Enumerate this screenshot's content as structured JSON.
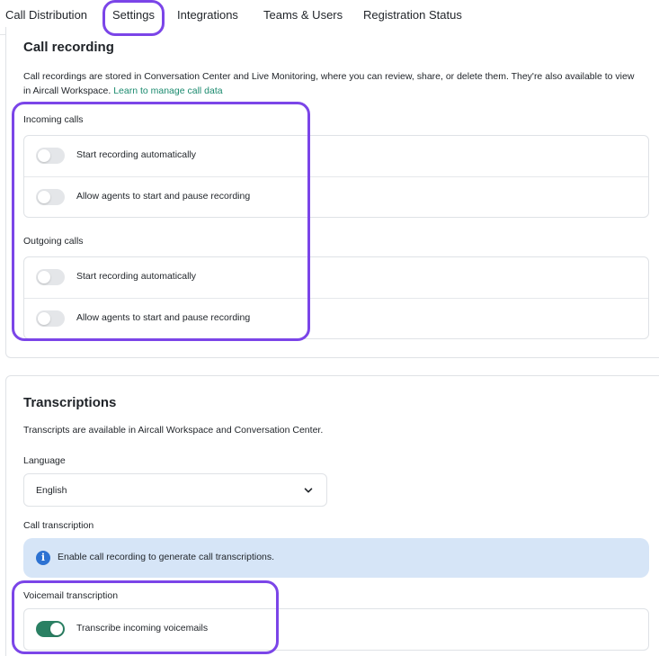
{
  "tabs": [
    {
      "label": "Call Distribution"
    },
    {
      "label": "Settings"
    },
    {
      "label": "Integrations"
    },
    {
      "label": "Teams & Users"
    },
    {
      "label": "Registration Status"
    }
  ],
  "call_recording": {
    "title": "Call recording",
    "description": "Call recordings are stored in Conversation Center and Live Monitoring, where you can review, share, or delete them. They're also available to view in Aircall Workspace.",
    "link": "Learn to manage call data",
    "incoming": {
      "label": "Incoming calls",
      "rows": [
        {
          "label": "Start recording automatically",
          "enabled": false
        },
        {
          "label": "Allow agents to start and pause recording",
          "enabled": false
        }
      ]
    },
    "outgoing": {
      "label": "Outgoing calls",
      "rows": [
        {
          "label": "Start recording automatically",
          "enabled": false
        },
        {
          "label": "Allow agents to start and pause recording",
          "enabled": false
        }
      ]
    }
  },
  "transcriptions": {
    "title": "Transcriptions",
    "description": "Transcripts are available in Aircall Workspace and Conversation Center.",
    "language_label": "Language",
    "language_value": "English",
    "call_transcription_label": "Call transcription",
    "banner_text": "Enable call recording to generate call transcriptions.",
    "voicemail_label": "Voicemail transcription",
    "voicemail_row": {
      "label": "Transcribe incoming voicemails",
      "enabled": true
    }
  },
  "colors": {
    "accent_highlight": "#7b45e8",
    "toggle_on": "#2a8063",
    "link": "#1a8a6e",
    "info_banner": "#d6e5f7"
  },
  "icons": {
    "banner": "info-icon",
    "select": "chevron-down-icon"
  }
}
